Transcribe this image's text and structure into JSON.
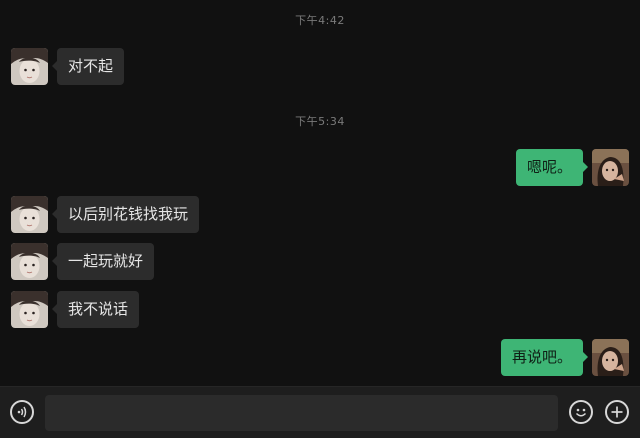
{
  "chat": {
    "timestamps": [
      "下午4:42",
      "下午5:34"
    ],
    "messages": [
      {
        "side": "in",
        "text": "对不起"
      },
      {
        "side": "out",
        "text": "嗯呢。"
      },
      {
        "side": "in",
        "text": "以后别花钱找我玩"
      },
      {
        "side": "in",
        "text": "一起玩就好"
      },
      {
        "side": "in",
        "text": "我不说话"
      },
      {
        "side": "out",
        "text": "再说吧。"
      }
    ]
  },
  "input_bar": {
    "voice_icon": "voice-icon",
    "emoji_icon": "emoji-icon",
    "plus_icon": "plus-icon",
    "message_value": ""
  },
  "colors": {
    "background": "#111111",
    "incoming_bubble": "#2c2c2c",
    "outgoing_bubble": "#3eb575",
    "input_bar": "#1e1e1e"
  }
}
